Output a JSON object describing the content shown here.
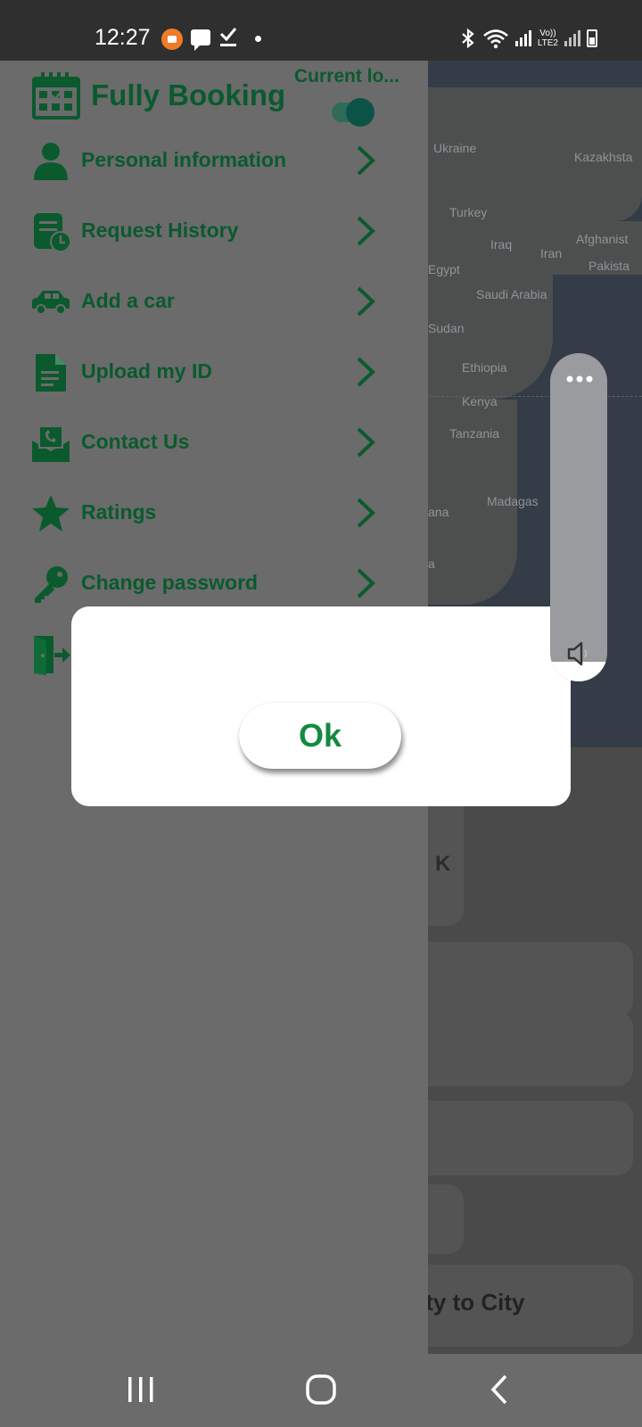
{
  "status_bar": {
    "time": "12:27",
    "network_label_top": "Vo))",
    "network_label_bottom": "LTE2",
    "icons": [
      "screen-recorder-icon",
      "message-icon",
      "task-done-icon",
      "notification-dot-icon",
      "bluetooth-icon",
      "wifi-icon",
      "signal-icon",
      "battery-icon"
    ]
  },
  "drawer": {
    "app_name": "Fully Booking",
    "current_location_label": "Current lo...",
    "current_location_enabled": true,
    "menu_items": [
      {
        "label": "Personal information",
        "icon": "person-icon"
      },
      {
        "label": "Request History",
        "icon": "request-history-icon"
      },
      {
        "label": "Add a car",
        "icon": "car-icon"
      },
      {
        "label": "Upload my ID",
        "icon": "document-icon"
      },
      {
        "label": "Contact Us",
        "icon": "contact-mail-icon"
      },
      {
        "label": "Ratings",
        "icon": "star-icon"
      },
      {
        "label": "Change password",
        "icon": "key-icon"
      },
      {
        "label": "",
        "icon": "logout-icon"
      }
    ]
  },
  "map": {
    "labels": [
      "Ukraine",
      "Kazakhsta",
      "Turkey",
      "Iraq",
      "Iran",
      "Afghanist",
      "Pakista",
      "Egypt",
      "Saudi Arabia",
      "Sudan",
      "Ethiopia",
      "Kenya",
      "Tanzania",
      "Madagas",
      "ana",
      "a"
    ]
  },
  "background": {
    "city_to_city_text": "ity to City",
    "fragment_text": "K"
  },
  "dialog": {
    "ok_label": "Ok"
  },
  "volume_panel": {
    "level": 0.06
  },
  "colors": {
    "brand_green": "#0a5a2e",
    "ok_green": "#138a3e",
    "overlay_gray": "#6b6b6b"
  }
}
